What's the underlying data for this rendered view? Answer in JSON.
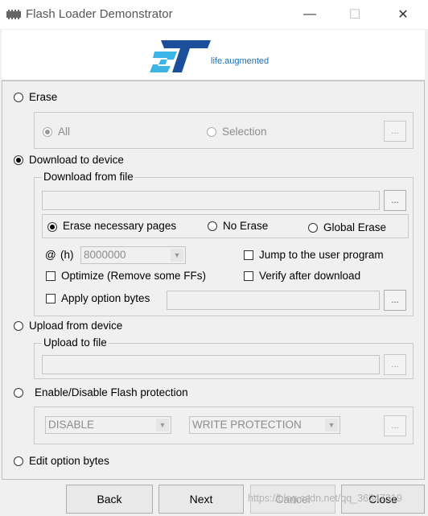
{
  "window": {
    "title": "Flash Loader Demonstrator",
    "minimize": "—",
    "maximize": "☐",
    "close": "✕"
  },
  "logo": {
    "brand": "ST",
    "tagline": "life.augmented"
  },
  "erase": {
    "label": "Erase",
    "all_label": "All",
    "selection_label": "Selection",
    "browse_label": "..."
  },
  "download": {
    "label": "Download to device",
    "from_file_label": "Download from file",
    "file_value": "",
    "browse_label": "...",
    "erase_necessary_label": "Erase necessary pages",
    "no_erase_label": "No Erase",
    "global_erase_label": "Global Erase",
    "address_at": "@",
    "address_h": "(h)",
    "address_value": "8000000",
    "jump_label": "Jump to the user program",
    "optimize_label": "Optimize (Remove some FFs)",
    "verify_label": "Verify after download",
    "apply_option_label": "Apply option bytes",
    "option_file_value": "",
    "option_browse_label": "..."
  },
  "upload": {
    "label": "Upload from device",
    "to_file_label": "Upload to file",
    "file_value": "",
    "browse_label": "..."
  },
  "protection": {
    "label": "Enable/Disable Flash protection",
    "mode_value": "DISABLE",
    "type_value": "WRITE PROTECTION",
    "browse_label": "..."
  },
  "edit_option": {
    "label": "Edit option bytes"
  },
  "footer": {
    "back": "Back",
    "next": "Next",
    "cancel": "Cancel",
    "close": "Close",
    "watermark": "https://blog.csdn.net/qq_36347319"
  },
  "colors": {
    "st_blue": "#1b4f9c",
    "st_cyan": "#3cb4e6"
  }
}
